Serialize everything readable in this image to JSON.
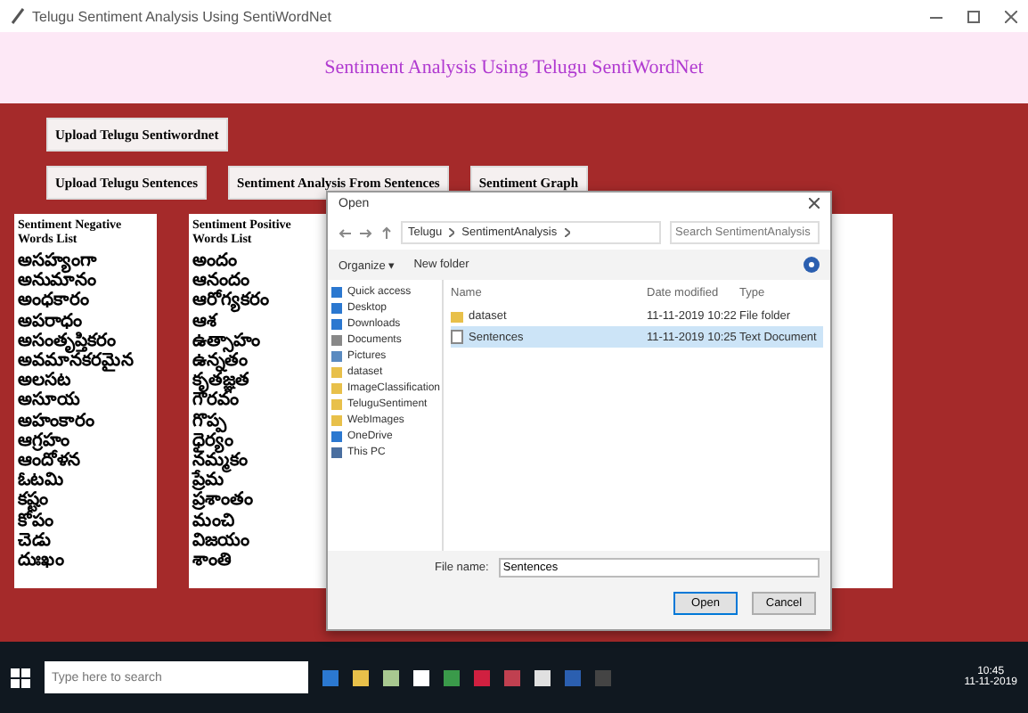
{
  "window": {
    "title": "Telugu Sentiment Analysis Using SentiWordNet"
  },
  "header": {
    "title": "Sentiment Analysis Using Telugu SentiWordNet"
  },
  "buttons_row1": [
    "Upload Telugu Sentiwordnet"
  ],
  "buttons_row2": [
    "Upload Telugu Sentences",
    "Sentiment Analysis From Sentences",
    "Sentiment Graph"
  ],
  "panels": [
    {
      "heading": "Sentiment Negative Words List",
      "words": [
        "అసహ్యంగా",
        "అనుమానం",
        "అంధకారం",
        "అపరాధం",
        "అసంతృప్తికరం",
        "అవమానకరమైన",
        "అలసట",
        "అసూయ",
        "అహంకారం",
        "ఆగ్రహం",
        "ఆందోళన",
        "ఓటమి",
        "కష్టం",
        "కోపం",
        "చెడు",
        "దుఃఖం"
      ]
    },
    {
      "heading": "Sentiment Positive Words List",
      "words": [
        "అందం",
        "ఆనందం",
        "ఆరోగ్యకరం",
        "ఆశ",
        "ఉత్సాహం",
        "ఉన్నతం",
        "కృతజ్ఞత",
        "గౌరవం",
        "గొప్ప",
        "ధైర్యం",
        "నమ్మకం",
        "ప్రేమ",
        "ప్రశాంతం",
        "మంచి",
        "విజయం",
        "శాంతి"
      ]
    }
  ],
  "dialog": {
    "title": "Open",
    "path": [
      "Telugu",
      "SentimentAnalysis"
    ],
    "search": {
      "placeholder": "Search SentimentAnalysis"
    },
    "toolbar": [
      "Organize ▾",
      "New folder"
    ],
    "nav": [
      {
        "label": "Quick access",
        "kind": "star"
      },
      {
        "label": "Desktop",
        "kind": "desktop"
      },
      {
        "label": "Downloads",
        "kind": "download"
      },
      {
        "label": "Documents",
        "kind": "doc"
      },
      {
        "label": "Pictures",
        "kind": "picture"
      },
      {
        "label": "dataset",
        "kind": "folder"
      },
      {
        "label": "ImageClassification",
        "kind": "folder"
      },
      {
        "label": "TeluguSentiment",
        "kind": "folder"
      },
      {
        "label": "WebImages",
        "kind": "folder"
      },
      {
        "label": "OneDrive",
        "kind": "cloud"
      },
      {
        "label": "This PC",
        "kind": "pc"
      }
    ],
    "columns": [
      "Name",
      "Date modified",
      "Type"
    ],
    "files": [
      {
        "name": "dataset",
        "date": "11-11-2019 10:22",
        "type": "File folder",
        "kind": "folder",
        "selected": false
      },
      {
        "name": "Sentences",
        "date": "11-11-2019 10:25",
        "type": "Text Document",
        "kind": "text",
        "selected": true
      }
    ],
    "file_name_label": "File name:",
    "file_name": "Sentences",
    "buttons": [
      "Open",
      "Cancel"
    ]
  },
  "taskbar": {
    "search": {
      "placeholder": "Type here to search"
    },
    "time": "10:45",
    "date": "11-11-2019"
  }
}
